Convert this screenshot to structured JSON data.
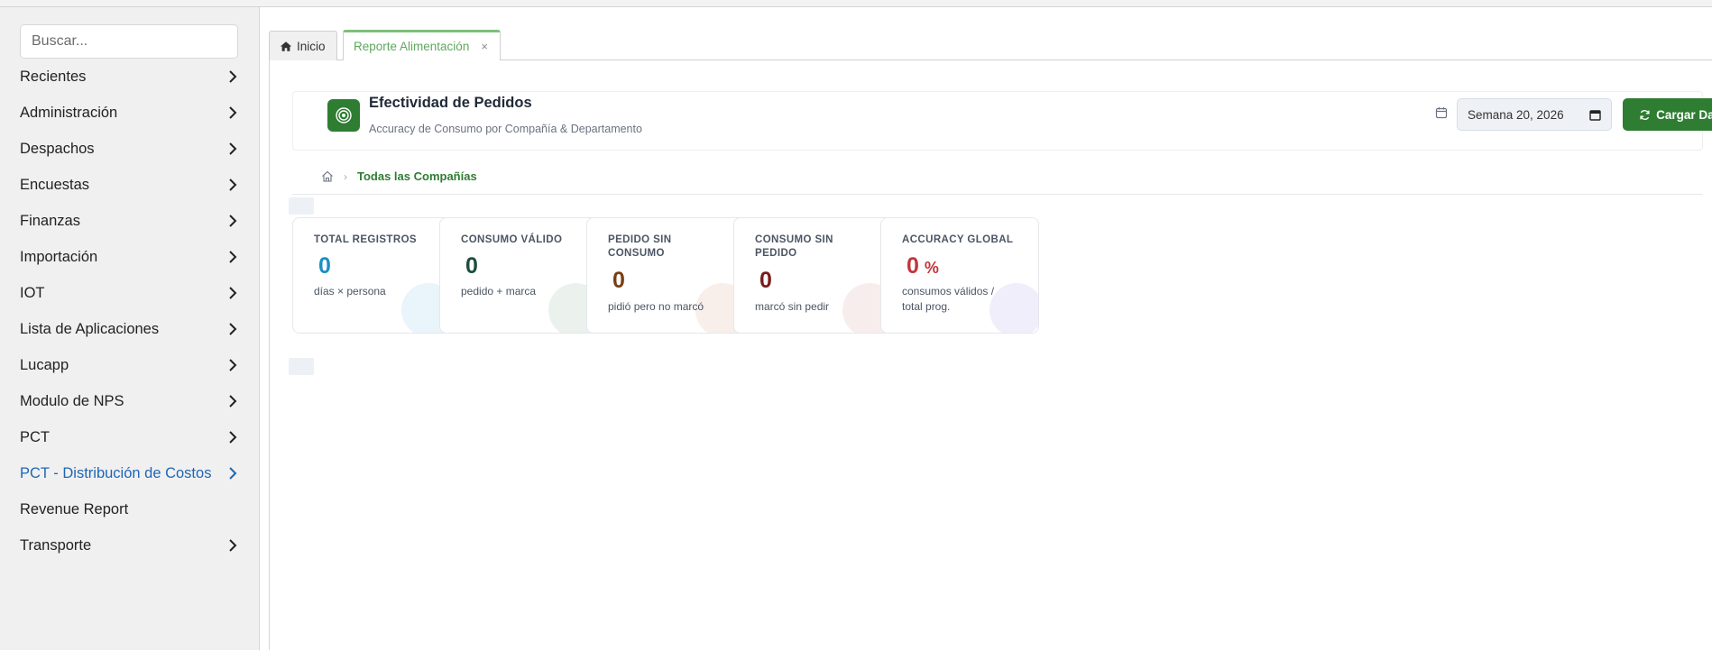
{
  "sidebar": {
    "search_placeholder": "Buscar...",
    "items": [
      {
        "label": "Recientes",
        "has_chevron": true
      },
      {
        "label": "Administración",
        "has_chevron": true
      },
      {
        "label": "Despachos",
        "has_chevron": true
      },
      {
        "label": "Encuestas",
        "has_chevron": true
      },
      {
        "label": "Finanzas",
        "has_chevron": true
      },
      {
        "label": "Importación",
        "has_chevron": true
      },
      {
        "label": "IOT",
        "has_chevron": true
      },
      {
        "label": "Lista de Aplicaciones",
        "has_chevron": true
      },
      {
        "label": "Lucapp",
        "has_chevron": true
      },
      {
        "label": "Modulo de NPS",
        "has_chevron": true
      },
      {
        "label": "PCT",
        "has_chevron": true
      },
      {
        "label": "PCT - Distribución de Costos",
        "has_chevron": true,
        "active": true
      },
      {
        "label": "Revenue Report",
        "has_chevron": false
      },
      {
        "label": "Transporte",
        "has_chevron": true
      }
    ]
  },
  "tabs": {
    "home_label": "Inicio",
    "report_label": "Reporte Alimentación",
    "close_symbol": "×"
  },
  "header": {
    "title": "Efectividad de Pedidos",
    "subtitle": "Accuracy de Consumo por Compañía & Departamento",
    "week_value": "Semana 20, 2026",
    "load_button": "Cargar Datos"
  },
  "breadcrumb": {
    "current": "Todas las Compañías"
  },
  "stats": [
    {
      "label": "TOTAL REGISTROS",
      "value": "0",
      "unit": "",
      "desc": "días × persona",
      "color": "#1b8fc4",
      "circle": "#eaf4fb"
    },
    {
      "label": "CONSUMO VÁLIDO",
      "value": "0",
      "unit": "",
      "desc": "pedido + marca",
      "color": "#1b4d3e",
      "circle": "#ebf2ee"
    },
    {
      "label": "PEDIDO SIN CONSUMO",
      "value": "0",
      "unit": "",
      "desc": "pidió pero no marcó",
      "color": "#7a3e12",
      "circle": "#f8eeea"
    },
    {
      "label": "CONSUMO SIN PEDIDO",
      "value": "0",
      "unit": "",
      "desc": "marcó sin pedir",
      "color": "#7a1a1a",
      "circle": "#f8eded"
    },
    {
      "label": "ACCURACY GLOBAL",
      "value": "0",
      "unit": "%",
      "desc": "consumos válidos / total prog.",
      "color": "#c0363b",
      "circle": "#f1eefb"
    }
  ],
  "colors": {
    "brand_green": "#2e7d32",
    "tab_active": "#5fa85f",
    "link_active": "#1f66b5"
  }
}
